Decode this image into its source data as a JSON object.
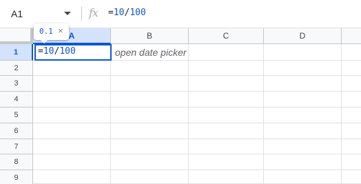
{
  "formula_bar": {
    "name_box": "A1",
    "fx_icon": "fx-icon",
    "formula": {
      "eq": "=",
      "num1": "10",
      "op": "/",
      "num2": "100"
    }
  },
  "grid": {
    "columns": [
      "A",
      "B",
      "C",
      "D"
    ],
    "rows": [
      "1",
      "2",
      "3",
      "4",
      "5",
      "6",
      "7",
      "8",
      "9"
    ],
    "selected_column": "A",
    "selected_row": "1",
    "cells": {
      "A1": {
        "eq": "=",
        "num1": "10",
        "op": "/",
        "num2": "100"
      },
      "B1": "open date picker"
    }
  },
  "preview_tooltip": {
    "value": "0.1",
    "close": "×"
  },
  "colors": {
    "accent": "#0b57d0",
    "number_token": "#1155cc",
    "header_bg": "#f8f9fa",
    "header_selected_bg": "#d3e3fd"
  }
}
